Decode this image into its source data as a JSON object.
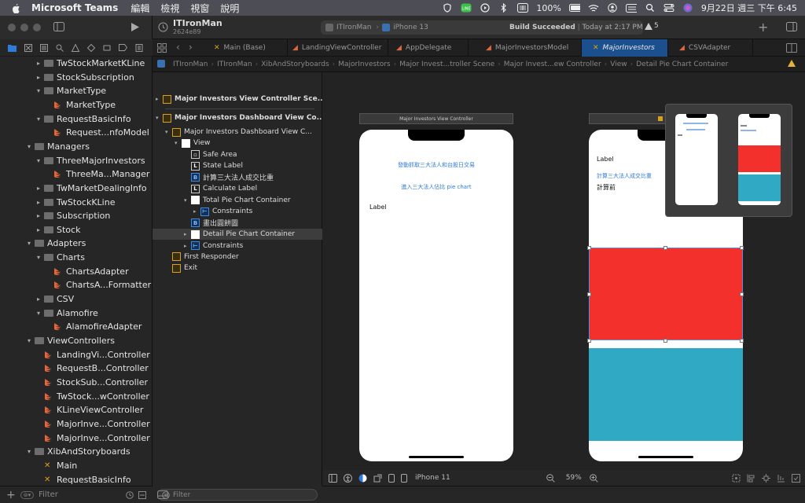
{
  "menubar": {
    "app": "Microsoft Teams",
    "items": [
      "編輯",
      "檢視",
      "視窗",
      "說明"
    ],
    "battery": "100%",
    "clock": "9月22日 週三 下午 6:45"
  },
  "toolbar": {
    "project": "ITIronMan",
    "commit": "2624e89",
    "scheme": "ITIronMan",
    "device": "iPhone 13",
    "build_status": "Build Succeeded",
    "build_time": "Today at 2:17 PM",
    "warnings": "5"
  },
  "tabs": [
    {
      "label": "Main (Base)"
    },
    {
      "label": "LandingViewController"
    },
    {
      "label": "AppDelegate"
    },
    {
      "label": "MajorInvestorsModel"
    },
    {
      "label": "MajorInvestors"
    },
    {
      "label": "CSVAdapter"
    }
  ],
  "jumpbar": [
    "ITIronMan",
    "ITIronMan",
    "XibAndStoryboards",
    "MajorInvestors",
    "Major Invest...troller Scene",
    "Major Invest...ew Controller",
    "View",
    "Detail Pie Chart Container"
  ],
  "navigator": [
    {
      "label": "TwStockMarketKLine",
      "level": 1,
      "type": "folder",
      "chevron": "▸"
    },
    {
      "label": "StockSubscription",
      "level": 1,
      "type": "folder",
      "chevron": "▸"
    },
    {
      "label": "MarketType",
      "level": 1,
      "type": "folder",
      "chevron": "▾"
    },
    {
      "label": "MarketType",
      "level": 2,
      "type": "swift",
      "chevron": ""
    },
    {
      "label": "RequestBasicInfo",
      "level": 1,
      "type": "folder",
      "chevron": "▾"
    },
    {
      "label": "Request...nfoModel",
      "level": 2,
      "type": "swift",
      "chevron": ""
    },
    {
      "label": "Managers",
      "level": 0,
      "type": "folder",
      "chevron": "▾"
    },
    {
      "label": "ThreeMajorInvestors",
      "level": 1,
      "type": "folder",
      "chevron": "▾"
    },
    {
      "label": "ThreeMa...Manager",
      "level": 2,
      "type": "swift",
      "chevron": ""
    },
    {
      "label": "TwMarketDealingInfo",
      "level": 1,
      "type": "folder",
      "chevron": "▸"
    },
    {
      "label": "TwStockKLine",
      "level": 1,
      "type": "folder",
      "chevron": "▸"
    },
    {
      "label": "Subscription",
      "level": 1,
      "type": "folder",
      "chevron": "▸"
    },
    {
      "label": "Stock",
      "level": 1,
      "type": "folder",
      "chevron": "▸"
    },
    {
      "label": "Adapters",
      "level": 0,
      "type": "folder",
      "chevron": "▾"
    },
    {
      "label": "Charts",
      "level": 1,
      "type": "folder",
      "chevron": "▾"
    },
    {
      "label": "ChartsAdapter",
      "level": 2,
      "type": "swift",
      "chevron": ""
    },
    {
      "label": "ChartsA...Formatter",
      "level": 2,
      "type": "swift",
      "chevron": ""
    },
    {
      "label": "CSV",
      "level": 1,
      "type": "folder",
      "chevron": "▸"
    },
    {
      "label": "Alamofire",
      "level": 1,
      "type": "folder",
      "chevron": "▾"
    },
    {
      "label": "AlamofireAdapter",
      "level": 2,
      "type": "swift",
      "chevron": ""
    },
    {
      "label": "ViewControllers",
      "level": 0,
      "type": "folder",
      "chevron": "▾"
    },
    {
      "label": "LandingVi...Controller",
      "level": 1,
      "type": "swift",
      "chevron": ""
    },
    {
      "label": "RequestB...Controller",
      "level": 1,
      "type": "swift",
      "chevron": ""
    },
    {
      "label": "StockSub...Controller",
      "level": 1,
      "type": "swift",
      "chevron": ""
    },
    {
      "label": "TwStock...wController",
      "level": 1,
      "type": "swift",
      "chevron": ""
    },
    {
      "label": "KLineViewController",
      "level": 1,
      "type": "swift",
      "chevron": ""
    },
    {
      "label": "MajorInve...Controller",
      "level": 1,
      "type": "swift",
      "chevron": ""
    },
    {
      "label": "MajorInve...Controller",
      "level": 1,
      "type": "swift",
      "chevron": ""
    },
    {
      "label": "XibAndStoryboards",
      "level": 0,
      "type": "folder",
      "chevron": "▾"
    },
    {
      "label": "Main",
      "level": 1,
      "type": "story",
      "chevron": ""
    },
    {
      "label": "RequestBasicInfo",
      "level": 1,
      "type": "story",
      "chevron": ""
    }
  ],
  "nav_filter": "Filter",
  "outline": [
    {
      "label": "Major Investors View Controller Sce...",
      "level": 0,
      "icon": "y",
      "chevron": "▸",
      "bold": true
    },
    {
      "label": "Major Investors Dashboard View Co...",
      "level": 0,
      "icon": "y",
      "chevron": "▾",
      "bold": true
    },
    {
      "label": "Major Investors Dashboard View C...",
      "level": 1,
      "icon": "y",
      "chevron": "▾"
    },
    {
      "label": "View",
      "level": 2,
      "icon": "w",
      "chevron": "▾"
    },
    {
      "label": "Safe Area",
      "level": 3,
      "icon": "s",
      "chevron": ""
    },
    {
      "label": "State Label",
      "level": 3,
      "icon": "L",
      "chevron": ""
    },
    {
      "label": "計算三大法人成交比重",
      "level": 3,
      "icon": "B",
      "chevron": ""
    },
    {
      "label": "Calculate Label",
      "level": 3,
      "icon": "L",
      "chevron": ""
    },
    {
      "label": "Total Pie Chart Container",
      "level": 3,
      "icon": "w",
      "chevron": "▾"
    },
    {
      "label": "Constraints",
      "level": 4,
      "icon": "c",
      "chevron": "▸"
    },
    {
      "label": "畫出圓餅圖",
      "level": 3,
      "icon": "B",
      "chevron": ""
    },
    {
      "label": "Detail Pie Chart Container",
      "level": 3,
      "icon": "w",
      "chevron": "▸",
      "selected": true
    },
    {
      "label": "Constraints",
      "level": 3,
      "icon": "c",
      "chevron": "▸"
    },
    {
      "label": "First Responder",
      "level": 1,
      "icon": "y",
      "chevron": ""
    },
    {
      "label": "Exit",
      "level": 1,
      "icon": "y",
      "chevron": ""
    }
  ],
  "outline_filter": "Filter",
  "scene1": {
    "title": "Major Investors View Controller",
    "btn1": "發動抓取三大法人和台股日交易",
    "btn2": "進入三大法人佔比 pie chart",
    "label": "Label"
  },
  "scene2": {
    "label": "Label",
    "btn": "計算三大法人成交比重",
    "calc": "計算前"
  },
  "canvas_bar": {
    "device": "iPhone 11",
    "zoom": "59%"
  },
  "colors": {
    "red": "#f3302c",
    "teal": "#2fa9c4",
    "accent": "#1b4f8e"
  }
}
